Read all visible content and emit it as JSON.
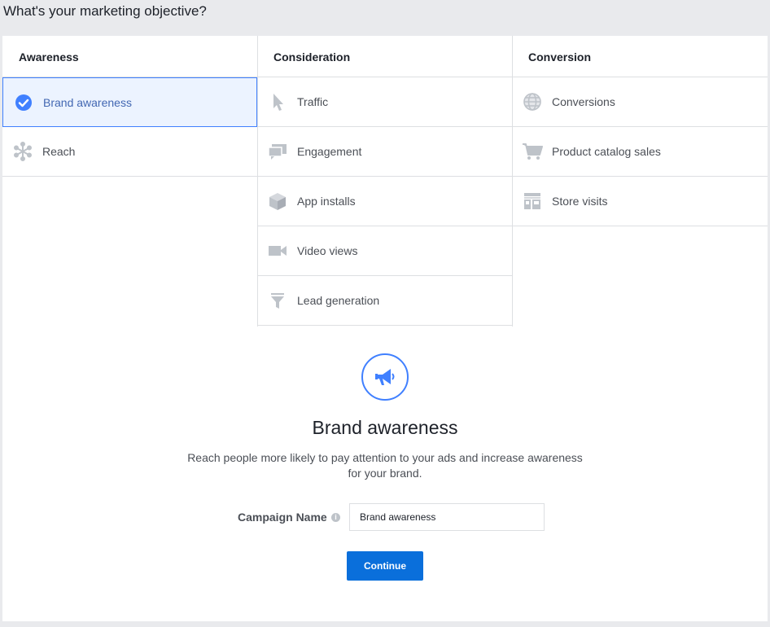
{
  "page": {
    "title": "What's your marketing objective?"
  },
  "columns": [
    {
      "header": "Awareness",
      "items": [
        {
          "label": "Brand awareness",
          "icon": "check-circle-icon",
          "selected": true
        },
        {
          "label": "Reach",
          "icon": "reach-icon",
          "selected": false
        }
      ]
    },
    {
      "header": "Consideration",
      "items": [
        {
          "label": "Traffic",
          "icon": "cursor-icon"
        },
        {
          "label": "Engagement",
          "icon": "chat-bubbles-icon"
        },
        {
          "label": "App installs",
          "icon": "box-icon"
        },
        {
          "label": "Video views",
          "icon": "video-camera-icon"
        },
        {
          "label": "Lead generation",
          "icon": "funnel-icon"
        }
      ]
    },
    {
      "header": "Conversion",
      "items": [
        {
          "label": "Conversions",
          "icon": "globe-icon"
        },
        {
          "label": "Product catalog sales",
          "icon": "cart-icon"
        },
        {
          "label": "Store visits",
          "icon": "store-icon"
        }
      ]
    }
  ],
  "detail": {
    "icon": "megaphone-icon",
    "title": "Brand awareness",
    "description": "Reach people more likely to pay attention to your ads and increase awareness for your brand."
  },
  "campaign": {
    "label": "Campaign Name",
    "value": "Brand awareness",
    "info": "i"
  },
  "continue_label": "Continue",
  "colors": {
    "accent": "#4080ff",
    "button": "#0a6fdb",
    "selected_bg": "#ecf3ff",
    "icon_gray": "#bec3c9"
  }
}
